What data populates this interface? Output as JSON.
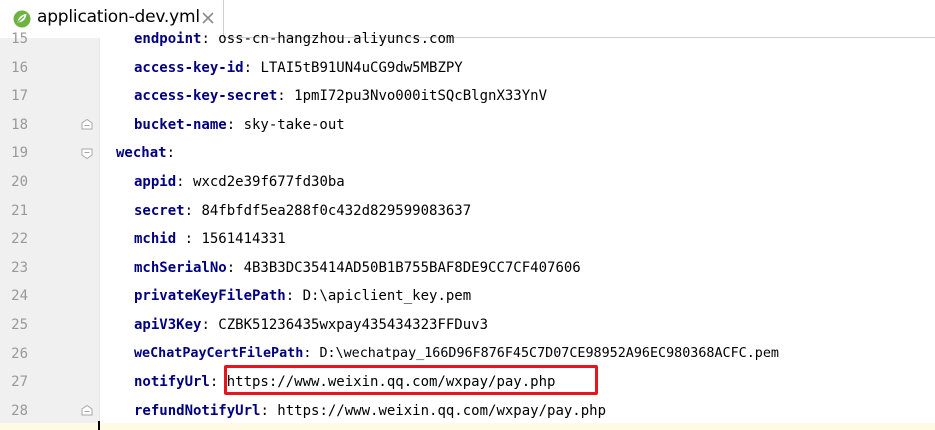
{
  "tab": {
    "title": "application-dev.yml",
    "icon": "spring-leaf-icon",
    "close_icon": "close-icon"
  },
  "colors": {
    "key": "#000080",
    "highlight_border": "#e8141c",
    "gutter_bg": "#f0f0f0",
    "line_number": "#999999"
  },
  "editor": {
    "lines": [
      {
        "number": "15",
        "key": "endpoint",
        "sep": ": ",
        "value": "oss-cn-hangzhou.aliyuncs.com",
        "partial": true
      },
      {
        "number": "16",
        "key": "access-key-id",
        "sep": ": ",
        "value": "LTAI5tB91UN4uCG9dw5MBZPY"
      },
      {
        "number": "17",
        "key": "access-key-secret",
        "sep": ": ",
        "value": "1pmI72pu3Nvo000itSQcBlgnX33YnV"
      },
      {
        "number": "18",
        "key": "bucket-name",
        "sep": ": ",
        "value": "sky-take-out"
      },
      {
        "number": "19",
        "key": "wechat",
        "sep": ":",
        "value": ""
      },
      {
        "number": "20",
        "key": "appid",
        "sep": ": ",
        "value": "wxcd2e39f677fd30ba"
      },
      {
        "number": "21",
        "key": "secret",
        "sep": ": ",
        "value": "84fbfdf5ea288f0c432d829599083637"
      },
      {
        "number": "22",
        "key": "mchid",
        "sep": " : ",
        "value": "1561414331"
      },
      {
        "number": "23",
        "key": "mchSerialNo",
        "sep": ": ",
        "value": "4B3B3DC35414AD50B1B755BAF8DE9CC7CF407606"
      },
      {
        "number": "24",
        "key": "privateKeyFilePath",
        "sep": ": ",
        "value": "D:\\apiclient_key.pem"
      },
      {
        "number": "25",
        "key": "apiV3Key",
        "sep": ": ",
        "value": "CZBK51236435wxpay435434323FFDuv3"
      },
      {
        "number": "26",
        "key": "weChatPayCertFilePath",
        "sep": ": ",
        "value": "D:\\wechatpay_166D96F876F45C7D07CE98952A96EC980368ACFC.pem"
      },
      {
        "number": "27",
        "key": "notifyUrl",
        "sep": ": ",
        "value": "https://www.weixin.qq.com/wxpay/pay.php"
      },
      {
        "number": "28",
        "key": "refundNotifyUrl",
        "sep": ": ",
        "value": "https://www.weixin.qq.com/wxpay/pay.php"
      }
    ]
  }
}
